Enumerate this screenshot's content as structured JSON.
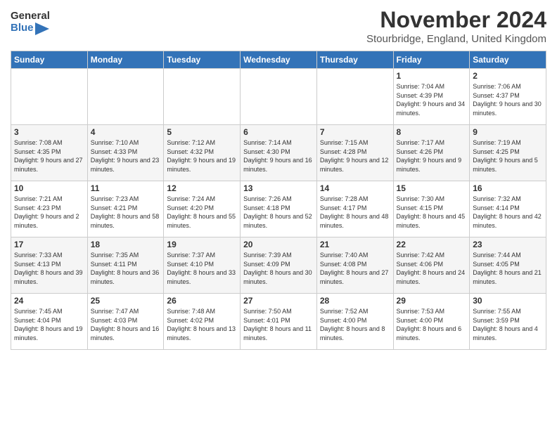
{
  "header": {
    "logo_line1": "General",
    "logo_line2": "Blue",
    "month_title": "November 2024",
    "subtitle": "Stourbridge, England, United Kingdom"
  },
  "weekdays": [
    "Sunday",
    "Monday",
    "Tuesday",
    "Wednesday",
    "Thursday",
    "Friday",
    "Saturday"
  ],
  "weeks": [
    [
      {
        "day": "",
        "info": ""
      },
      {
        "day": "",
        "info": ""
      },
      {
        "day": "",
        "info": ""
      },
      {
        "day": "",
        "info": ""
      },
      {
        "day": "",
        "info": ""
      },
      {
        "day": "1",
        "info": "Sunrise: 7:04 AM\nSunset: 4:39 PM\nDaylight: 9 hours and 34 minutes."
      },
      {
        "day": "2",
        "info": "Sunrise: 7:06 AM\nSunset: 4:37 PM\nDaylight: 9 hours and 30 minutes."
      }
    ],
    [
      {
        "day": "3",
        "info": "Sunrise: 7:08 AM\nSunset: 4:35 PM\nDaylight: 9 hours and 27 minutes."
      },
      {
        "day": "4",
        "info": "Sunrise: 7:10 AM\nSunset: 4:33 PM\nDaylight: 9 hours and 23 minutes."
      },
      {
        "day": "5",
        "info": "Sunrise: 7:12 AM\nSunset: 4:32 PM\nDaylight: 9 hours and 19 minutes."
      },
      {
        "day": "6",
        "info": "Sunrise: 7:14 AM\nSunset: 4:30 PM\nDaylight: 9 hours and 16 minutes."
      },
      {
        "day": "7",
        "info": "Sunrise: 7:15 AM\nSunset: 4:28 PM\nDaylight: 9 hours and 12 minutes."
      },
      {
        "day": "8",
        "info": "Sunrise: 7:17 AM\nSunset: 4:26 PM\nDaylight: 9 hours and 9 minutes."
      },
      {
        "day": "9",
        "info": "Sunrise: 7:19 AM\nSunset: 4:25 PM\nDaylight: 9 hours and 5 minutes."
      }
    ],
    [
      {
        "day": "10",
        "info": "Sunrise: 7:21 AM\nSunset: 4:23 PM\nDaylight: 9 hours and 2 minutes."
      },
      {
        "day": "11",
        "info": "Sunrise: 7:23 AM\nSunset: 4:21 PM\nDaylight: 8 hours and 58 minutes."
      },
      {
        "day": "12",
        "info": "Sunrise: 7:24 AM\nSunset: 4:20 PM\nDaylight: 8 hours and 55 minutes."
      },
      {
        "day": "13",
        "info": "Sunrise: 7:26 AM\nSunset: 4:18 PM\nDaylight: 8 hours and 52 minutes."
      },
      {
        "day": "14",
        "info": "Sunrise: 7:28 AM\nSunset: 4:17 PM\nDaylight: 8 hours and 48 minutes."
      },
      {
        "day": "15",
        "info": "Sunrise: 7:30 AM\nSunset: 4:15 PM\nDaylight: 8 hours and 45 minutes."
      },
      {
        "day": "16",
        "info": "Sunrise: 7:32 AM\nSunset: 4:14 PM\nDaylight: 8 hours and 42 minutes."
      }
    ],
    [
      {
        "day": "17",
        "info": "Sunrise: 7:33 AM\nSunset: 4:13 PM\nDaylight: 8 hours and 39 minutes."
      },
      {
        "day": "18",
        "info": "Sunrise: 7:35 AM\nSunset: 4:11 PM\nDaylight: 8 hours and 36 minutes."
      },
      {
        "day": "19",
        "info": "Sunrise: 7:37 AM\nSunset: 4:10 PM\nDaylight: 8 hours and 33 minutes."
      },
      {
        "day": "20",
        "info": "Sunrise: 7:39 AM\nSunset: 4:09 PM\nDaylight: 8 hours and 30 minutes."
      },
      {
        "day": "21",
        "info": "Sunrise: 7:40 AM\nSunset: 4:08 PM\nDaylight: 8 hours and 27 minutes."
      },
      {
        "day": "22",
        "info": "Sunrise: 7:42 AM\nSunset: 4:06 PM\nDaylight: 8 hours and 24 minutes."
      },
      {
        "day": "23",
        "info": "Sunrise: 7:44 AM\nSunset: 4:05 PM\nDaylight: 8 hours and 21 minutes."
      }
    ],
    [
      {
        "day": "24",
        "info": "Sunrise: 7:45 AM\nSunset: 4:04 PM\nDaylight: 8 hours and 19 minutes."
      },
      {
        "day": "25",
        "info": "Sunrise: 7:47 AM\nSunset: 4:03 PM\nDaylight: 8 hours and 16 minutes."
      },
      {
        "day": "26",
        "info": "Sunrise: 7:48 AM\nSunset: 4:02 PM\nDaylight: 8 hours and 13 minutes."
      },
      {
        "day": "27",
        "info": "Sunrise: 7:50 AM\nSunset: 4:01 PM\nDaylight: 8 hours and 11 minutes."
      },
      {
        "day": "28",
        "info": "Sunrise: 7:52 AM\nSunset: 4:00 PM\nDaylight: 8 hours and 8 minutes."
      },
      {
        "day": "29",
        "info": "Sunrise: 7:53 AM\nSunset: 4:00 PM\nDaylight: 8 hours and 6 minutes."
      },
      {
        "day": "30",
        "info": "Sunrise: 7:55 AM\nSunset: 3:59 PM\nDaylight: 8 hours and 4 minutes."
      }
    ]
  ]
}
